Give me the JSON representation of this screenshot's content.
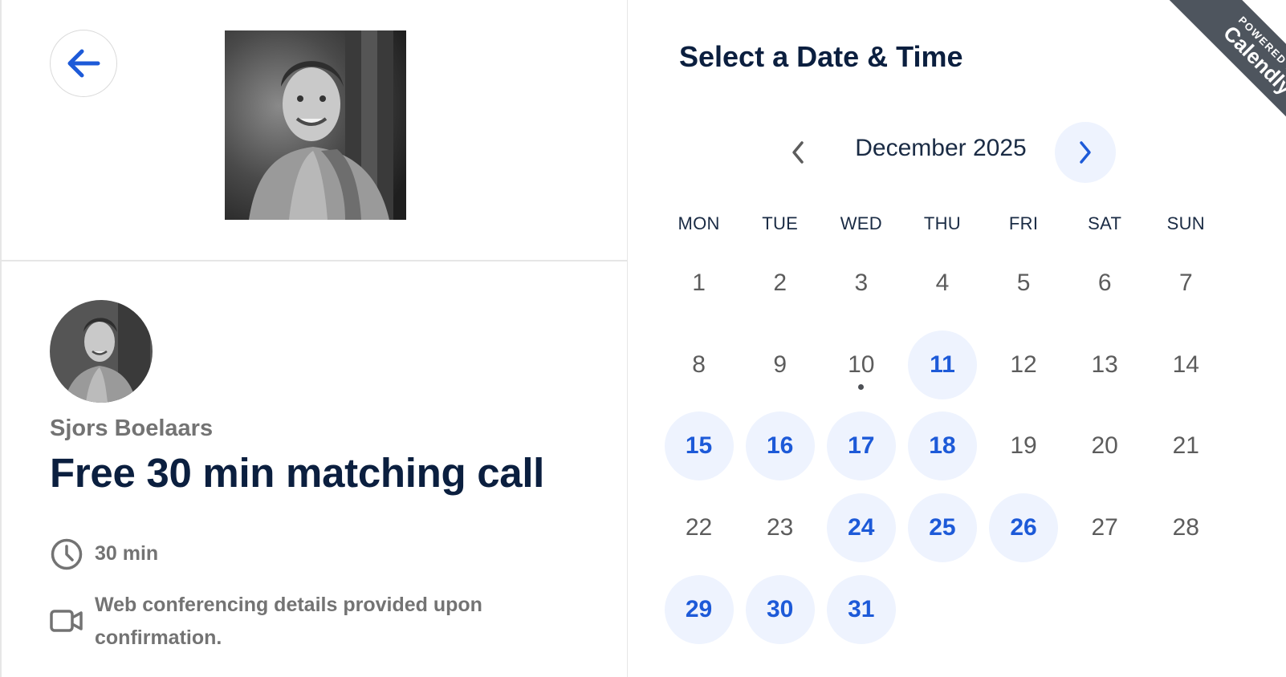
{
  "colors": {
    "accent": "#1d5ad8",
    "available_bg": "#eef3fe",
    "title": "#0b1f3f",
    "muted": "#737373",
    "ribbon": "#4e555e"
  },
  "left": {
    "back_icon": "arrow-left-icon",
    "host_name": "Sjors Boelaars",
    "event_title": "Free 30 min matching call",
    "duration": {
      "icon": "clock-icon",
      "text": "30 min"
    },
    "conferencing": {
      "icon": "video-camera-icon",
      "text": "Web conferencing details provided upon confirmation."
    }
  },
  "calendar": {
    "title": "Select a Date & Time",
    "month_label": "December 2025",
    "prev_icon": "chevron-left-icon",
    "next_icon": "chevron-right-icon",
    "weekdays": [
      "MON",
      "TUE",
      "WED",
      "THU",
      "FRI",
      "SAT",
      "SUN"
    ],
    "first_weekday_offset": 0,
    "days_in_month": 31,
    "today": 10,
    "available_days": [
      11,
      15,
      16,
      17,
      18,
      24,
      25,
      26,
      29,
      30,
      31
    ]
  },
  "ribbon": {
    "powered_by": "POWERED BY",
    "brand": "Calendly"
  }
}
